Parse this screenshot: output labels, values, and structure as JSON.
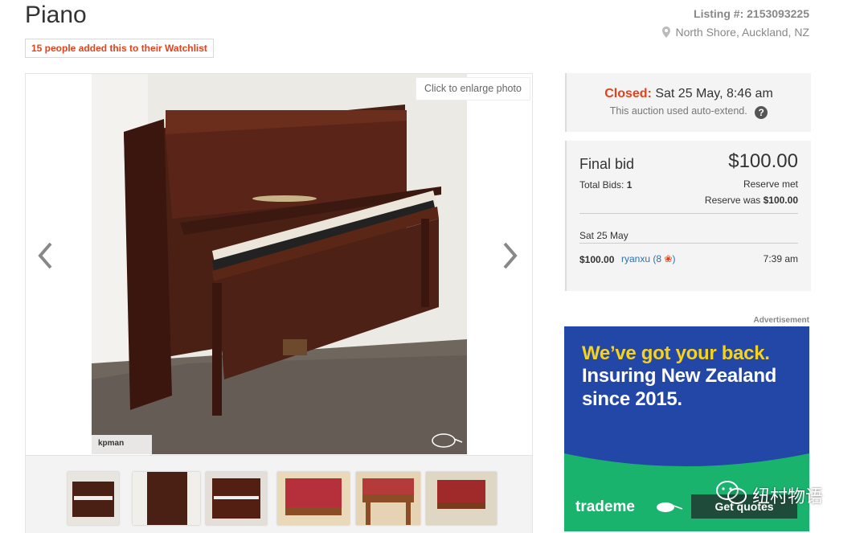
{
  "listing": {
    "title": "Piano",
    "watchlist_text": "15 people added this to their Watchlist",
    "listing_number": "Listing #: 2153093225",
    "location": "North Shore, Auckland, NZ"
  },
  "gallery": {
    "enlarge_label": "Click to enlarge photo",
    "seller_tag": "kpman",
    "prev_icon": "chevron-left-icon",
    "next_icon": "chevron-right-icon",
    "thumbnails": [
      "piano-front",
      "piano-side",
      "piano-angle",
      "stool-top",
      "stool-front",
      "stool-side"
    ]
  },
  "status": {
    "closed_label": "Closed:",
    "closed_date": "Sat 25 May, 8:46 am",
    "auto_extend": "This auction used auto-extend.",
    "help_icon": "?"
  },
  "bid": {
    "final_label": "Final bid",
    "final_amount": "$100.00",
    "total_bids_label": "Total Bids:",
    "total_bids": "1",
    "reserve_met": "Reserve met",
    "reserve_was_label": "Reserve was",
    "reserve_was": "$100.00",
    "history_date": "Sat 25 May",
    "history_amount": "$100.00",
    "bidder_name": "ryanxu",
    "bidder_rating": "8",
    "history_time": "7:39 am"
  },
  "ad": {
    "label": "Advertisement",
    "line1": "We’ve got your back.",
    "line2": "Insuring New Zealand",
    "line3": "since 2015.",
    "brand": "trademe",
    "cta": "Get quotes",
    "colors": {
      "navy": "#2347a7",
      "yellow": "#f6d21b",
      "green": "#1ab36e"
    }
  },
  "watermark": "纽村物语"
}
